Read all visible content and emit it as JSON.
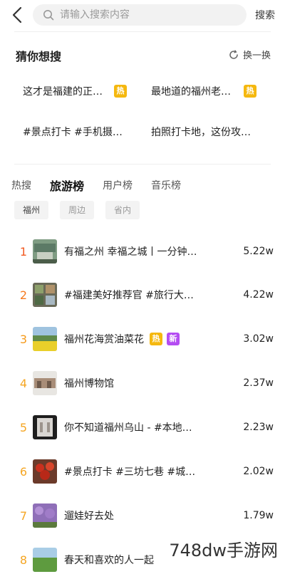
{
  "search": {
    "placeholder": "请输入搜索内容",
    "button": "搜索"
  },
  "guess": {
    "title": "猜你想搜",
    "refresh_label": "换一换",
    "items": [
      {
        "text": "这才是福建的正…",
        "badge": "热"
      },
      {
        "text": "最地道的福州老…",
        "badge": "热"
      },
      {
        "text": "#景点打卡 #手机摄…",
        "badge": ""
      },
      {
        "text": "拍照打卡地，这份攻…",
        "badge": ""
      }
    ]
  },
  "tabs": [
    "热搜",
    "旅游榜",
    "用户榜",
    "音乐榜"
  ],
  "active_tab": "旅游榜",
  "chips": [
    "福州",
    "周边",
    "省内"
  ],
  "active_chip": "福州",
  "ranking": [
    {
      "rank": "1",
      "title": "有福之州 幸福之城丨一分钟…",
      "count": "5.22w",
      "badges": []
    },
    {
      "rank": "2",
      "title": "#福建美好推荐官 #旅行大…",
      "count": "4.22w",
      "badges": []
    },
    {
      "rank": "3",
      "title": "福州花海赏油菜花",
      "count": "3.02w",
      "badges": [
        "热",
        "新"
      ]
    },
    {
      "rank": "4",
      "title": "福州博物馆",
      "count": "2.37w",
      "badges": []
    },
    {
      "rank": "5",
      "title": "你不知道福州乌山 - #本地…",
      "count": "2.23w",
      "badges": []
    },
    {
      "rank": "6",
      "title": "#景点打卡 #三坊七巷 #城…",
      "count": "2.02w",
      "badges": []
    },
    {
      "rank": "7",
      "title": "遛娃好去处",
      "count": "1.79w",
      "badges": []
    },
    {
      "rank": "8",
      "title": "春天和喜欢的人一起",
      "count": "",
      "badges": []
    }
  ],
  "colors": {
    "rank_1": "#f25a22",
    "rank_2": "#f57a1f",
    "rank_3": "#f59a1a",
    "rank_rest": "#f5a623",
    "hot_badge": "#f5b80f",
    "new_badge": "#b44cf2"
  },
  "watermark": "748dw手游网"
}
